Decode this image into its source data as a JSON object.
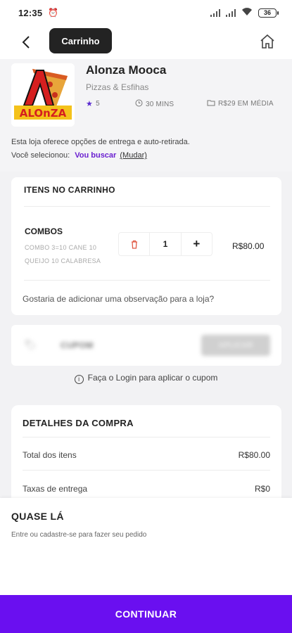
{
  "status_bar": {
    "time": "12:35",
    "battery": "36"
  },
  "header": {
    "title": "Carrinho"
  },
  "store": {
    "logo_text": "ALOnZA",
    "name": "Alonza Mooca",
    "category": "Pizzas & Esfihas",
    "rating": "5",
    "delivery_time": "30 MINS",
    "avg_price": "R$29 EM MÉDIA",
    "options_text": "Esta loja oferece opções de entrega e auto-retirada.",
    "selected_prefix": "Você selecionou:",
    "selected_value": "Vou buscar",
    "change_label": "(Mudar)"
  },
  "cart": {
    "title": "ITENS NO CARRINHO",
    "items": [
      {
        "name": "COMBOS",
        "description": "COMBO 3=10 CANE 10 QUEIJO 10 CALABRESA",
        "quantity": "1",
        "price": "R$80.00"
      }
    ],
    "note_prompt": "Gostaria de adicionar uma observação para a loja?"
  },
  "coupon": {
    "label": "CUPOM",
    "apply_label": "APLICAR",
    "login_hint": "Faça o Login para aplicar o cupom"
  },
  "details": {
    "title": "DETALHES DA COMPRA",
    "rows": [
      {
        "label": "Total dos itens",
        "value": "R$80.00"
      },
      {
        "label": "Taxas de entrega",
        "value": "R$0"
      }
    ]
  },
  "sheet": {
    "title": "QUASE LÁ",
    "subtitle": "Entre ou cadastre-se para fazer seu pedido"
  },
  "continue_label": "CONTINUAR",
  "colors": {
    "brand": "#6a0ff0",
    "accent_text": "#6a1fd0",
    "delete": "#e05a45",
    "pill": "#232323"
  }
}
